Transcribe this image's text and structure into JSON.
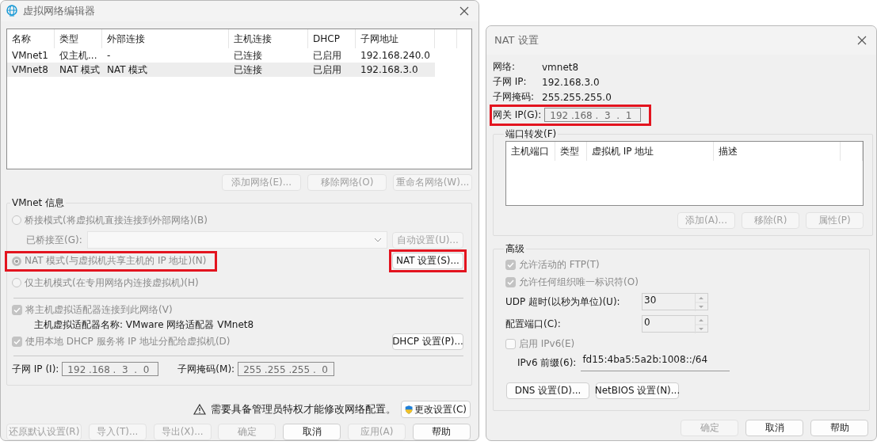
{
  "left_window": {
    "title": "虚拟网络编辑器",
    "table": {
      "columns": [
        "名称",
        "类型",
        "外部连接",
        "主机连接",
        "DHCP",
        "子网地址"
      ],
      "rows": [
        {
          "cells": [
            "VMnet1",
            "仅主机...",
            "-",
            "已连接",
            "已启用",
            "192.168.240.0"
          ],
          "selected": false
        },
        {
          "cells": [
            "VMnet8",
            "NAT 模式",
            "NAT 模式",
            "已连接",
            "已启用",
            "192.168.3.0"
          ],
          "selected": true
        }
      ]
    },
    "table_buttons": [
      {
        "label": "添加网络(E)...",
        "disabled": true
      },
      {
        "label": "移除网络(O)",
        "disabled": true
      },
      {
        "label": "重命名网络(W)...",
        "disabled": true
      }
    ],
    "vmnet_info": {
      "title": "VMnet 信息",
      "modes": [
        {
          "label": "桥接模式(将虚拟机直接连接到外部网络)(B)",
          "selected": false,
          "highlighted": false
        },
        {
          "label": "NAT 模式(与虚拟机共享主机的 IP 地址)(N)",
          "selected": true,
          "highlighted": true
        },
        {
          "label": "仅主机模式(在专用网络内连接虚拟机)(H)",
          "selected": false,
          "highlighted": false
        }
      ],
      "bridged_to": {
        "label": "已桥接至(G):",
        "disabled": true
      },
      "auto_button": {
        "label": "自动设置(U)...",
        "disabled": true
      },
      "nat_button": {
        "label": "NAT 设置(S)...",
        "highlighted": true
      },
      "connect_adapter": {
        "label": "将主机虚拟适配器连接到此网络(V)",
        "checked": true
      },
      "adapter_name": "主机虚拟适配器名称: VMware 网络适配器 VMnet8",
      "dhcp": {
        "label": "使用本地 DHCP 服务将 IP 地址分配给虚拟机(D)",
        "checked": true
      },
      "dhcp_button": {
        "label": "DHCP 设置(P)..."
      },
      "subnet_ip": {
        "label": "子网 IP (I):",
        "value": "192 .168 .  3  .  0"
      },
      "subnet_mask": {
        "label": "子网掩码(M):",
        "value": "255 .255 .255 .  0"
      }
    },
    "admin_notice": "需要具备管理员特权才能修改网络配置。",
    "change_settings_button": "更改设置(C)",
    "footer_buttons": [
      {
        "label": "还原默认设置(R)",
        "disabled": true
      },
      {
        "label": "导入(T)...",
        "disabled": true
      },
      {
        "label": "导出(X)...",
        "disabled": true
      },
      {
        "label": "确定",
        "disabled": true
      },
      {
        "label": "取消",
        "disabled": false
      },
      {
        "label": "应用(A)",
        "disabled": true
      },
      {
        "label": "帮助",
        "disabled": false
      }
    ]
  },
  "nat_window": {
    "title": "NAT 设置",
    "info": [
      {
        "label": "网络:",
        "value": "vmnet8"
      },
      {
        "label": "子网 IP:",
        "value": "192.168.3.0"
      },
      {
        "label": "子网掩码:",
        "value": "255.255.255.0"
      }
    ],
    "gateway": {
      "label": "网关 IP(G):",
      "value": "192 .168 .  3  .  1",
      "highlighted": true
    },
    "port_forwarding": {
      "title": "端口转发(F)",
      "columns": [
        "主机端口",
        "类型",
        "虚拟机 IP 地址",
        "描述"
      ],
      "buttons": [
        {
          "label": "添加(A)...",
          "disabled": true
        },
        {
          "label": "移除(R)",
          "disabled": true
        },
        {
          "label": "属性(P)",
          "disabled": true
        }
      ]
    },
    "advanced": {
      "title": "高级",
      "checks": [
        {
          "label": "允许活动的 FTP(T)",
          "checked": true
        },
        {
          "label": "允许任何组织唯一标识符(O)",
          "checked": true
        }
      ],
      "spinners": [
        {
          "label": "UDP 超时(以秒为单位)(U):",
          "value": "30"
        },
        {
          "label": "配置端口(C):",
          "value": "0"
        }
      ],
      "ipv6": {
        "label": "启用 IPv6(E)",
        "checked": false
      },
      "ipv6_prefix": {
        "label": "IPv6 前缀(6):",
        "value": "fd15:4ba5:5a2b:1008::/64"
      },
      "buttons": [
        "DNS 设置(D)...",
        "NetBIOS 设置(N)..."
      ]
    },
    "footer_buttons": [
      {
        "label": "确定",
        "disabled": true
      },
      {
        "label": "取消",
        "disabled": false
      },
      {
        "label": "帮助",
        "disabled": false
      }
    ]
  }
}
